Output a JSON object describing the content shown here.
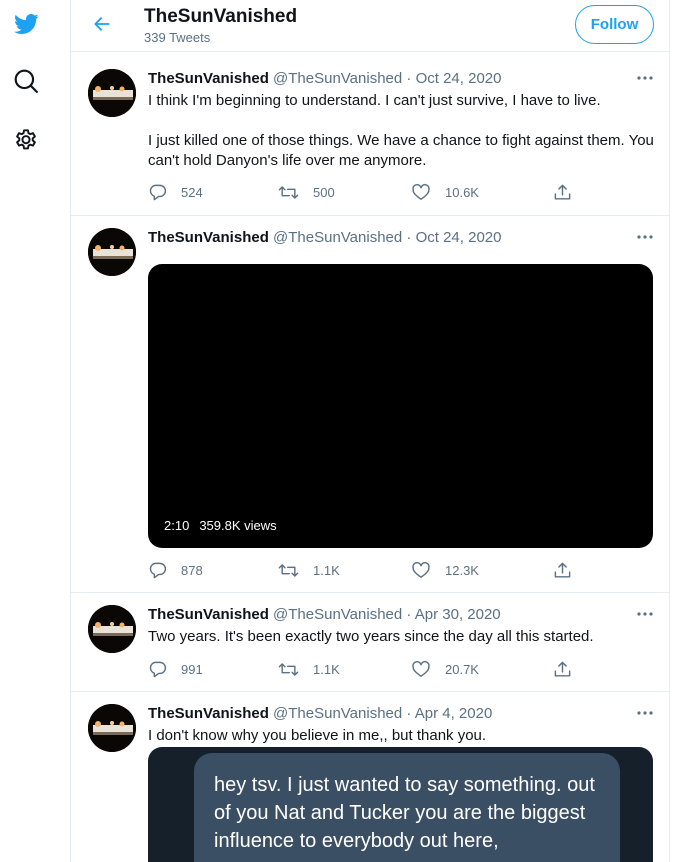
{
  "sidebar": {
    "icons": [
      "twitter-logo-icon",
      "search-icon",
      "gear-icon"
    ]
  },
  "header": {
    "name": "TheSunVanished",
    "tweet_count": "339 Tweets",
    "follow_label": "Follow"
  },
  "colors": {
    "accent": "#1da1f2",
    "muted": "#5b7083",
    "divider": "#e6ecf0"
  },
  "tweets": [
    {
      "name": "TheSunVanished",
      "handle": "@TheSunVanished",
      "separator": "·",
      "date": "Oct 24, 2020",
      "text": "I think I'm beginning to understand. I can't just survive, I have to live.\n\nI just killed one of those things. We have a chance to fight against them. You can't hold Danyon's life over me anymore.",
      "replies": "524",
      "retweets": "500",
      "likes": "10.6K"
    },
    {
      "name": "TheSunVanished",
      "handle": "@TheSunVanished",
      "separator": "·",
      "date": "Oct 24, 2020",
      "video": {
        "duration": "2:10",
        "views": "359.8K views"
      },
      "replies": "878",
      "retweets": "1.1K",
      "likes": "12.3K"
    },
    {
      "name": "TheSunVanished",
      "handle": "@TheSunVanished",
      "separator": "·",
      "date": "Apr 30, 2020",
      "text": "Two years. It's been exactly two years since the day all this started.",
      "replies": "991",
      "retweets": "1.1K",
      "likes": "20.7K"
    },
    {
      "name": "TheSunVanished",
      "handle": "@TheSunVanished",
      "separator": "·",
      "date": "Apr 4, 2020",
      "text": "I don't know why you believe in me,, but thank you.",
      "image_text": "hey tsv. I just wanted to say something. out of you Nat and Tucker you are the biggest influence to everybody out here,"
    }
  ]
}
